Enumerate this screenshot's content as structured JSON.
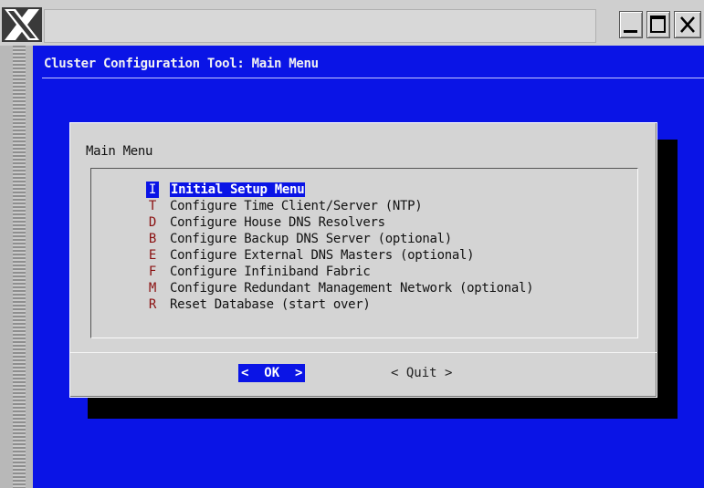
{
  "window": {
    "logo_icon": "x-logo-icon",
    "controls": [
      "minimize-icon",
      "maximize-icon",
      "close-icon"
    ]
  },
  "screen": {
    "title": "Cluster Configuration Tool: Main Menu",
    "background_color": "#0a14e6"
  },
  "dialog": {
    "title": "Main Menu",
    "items": [
      {
        "key": "I",
        "label": "Initial Setup Menu",
        "selected": true
      },
      {
        "key": "T",
        "label": "Configure Time Client/Server (NTP)"
      },
      {
        "key": "D",
        "label": "Configure House DNS Resolvers"
      },
      {
        "key": "B",
        "label": "Configure Backup DNS Server (optional)"
      },
      {
        "key": "E",
        "label": "Configure External DNS Masters (optional)"
      },
      {
        "key": "F",
        "label": "Configure Infiniband Fabric"
      },
      {
        "key": "M",
        "label": "Configure Redundant Management Network (optional)"
      },
      {
        "key": "R",
        "label": "Reset Database (start over)"
      }
    ],
    "ok_label": "<  OK  >",
    "quit_label": "< Quit >"
  }
}
